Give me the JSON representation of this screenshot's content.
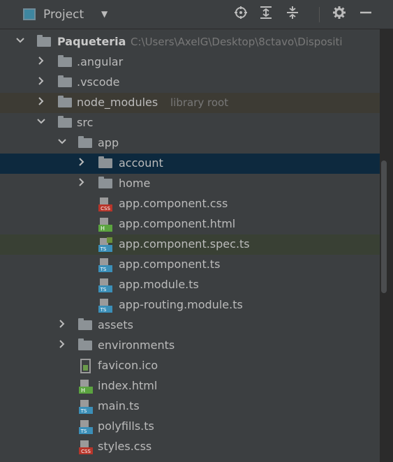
{
  "header": {
    "title": "Project",
    "dropdown_icon": "triangle-down-icon",
    "toolbar_icons": [
      "locate-icon",
      "expand-all-icon",
      "collapse-all-icon",
      "gear-icon",
      "minimize-icon"
    ]
  },
  "tree": {
    "root": {
      "label": "Paqueteria",
      "path": "C:\\Users\\AxelG\\Desktop\\8ctavo\\Dispositi"
    },
    "items": [
      {
        "label": ".angular"
      },
      {
        "label": ".vscode"
      },
      {
        "label": "node_modules",
        "note": "library root"
      },
      {
        "label": "src"
      },
      {
        "label": "app"
      },
      {
        "label": "account"
      },
      {
        "label": "home"
      },
      {
        "label": "app.component.css"
      },
      {
        "label": "app.component.html"
      },
      {
        "label": "app.component.spec.ts"
      },
      {
        "label": "app.component.ts"
      },
      {
        "label": "app.module.ts"
      },
      {
        "label": "app-routing.module.ts"
      },
      {
        "label": "assets"
      },
      {
        "label": "environments"
      },
      {
        "label": "favicon.ico"
      },
      {
        "label": "index.html"
      },
      {
        "label": "main.ts"
      },
      {
        "label": "polyfills.ts"
      },
      {
        "label": "styles.css"
      }
    ]
  },
  "colors": {
    "background": "#3c3f41",
    "selected_row": "#0d293e",
    "library_row": "#3d3b34",
    "spec_row": "#394034",
    "folder": "#8c9296",
    "ts_badge": "#3b8fb8",
    "css_badge": "#b8352a",
    "html_badge": "#5ba33f"
  }
}
